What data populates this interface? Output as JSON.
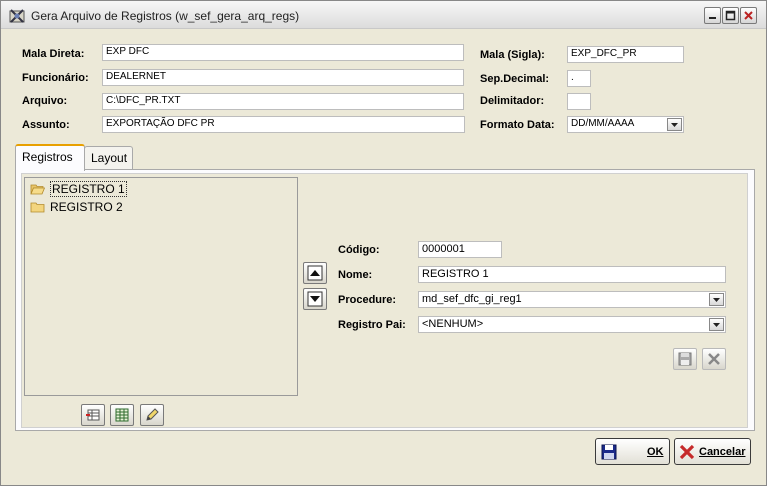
{
  "window": {
    "title": "Gera Arquivo de Registros (w_sef_gera_arq_regs)"
  },
  "form": {
    "mala_direta": {
      "label": "Mala Direta:",
      "value": "EXP DFC"
    },
    "funcionario": {
      "label": "Funcionário:",
      "value": "DEALERNET"
    },
    "arquivo": {
      "label": "Arquivo:",
      "value": "C:\\DFC_PR.TXT"
    },
    "assunto": {
      "label": "Assunto:",
      "value": "EXPORTAÇÃO DFC PR"
    },
    "mala_sigla": {
      "label": "Mala (Sigla):",
      "value": "EXP_DFC_PR"
    },
    "sep_decimal": {
      "label": "Sep.Decimal:",
      "value": "."
    },
    "delimitador": {
      "label": "Delimitador:",
      "value": ""
    },
    "formato_data": {
      "label": "Formato Data:",
      "value": "DD/MM/AAAA"
    }
  },
  "tabs": [
    {
      "label": "Registros",
      "active": true
    },
    {
      "label": "Layout",
      "active": false
    }
  ],
  "tree": {
    "items": [
      {
        "label": "REGISTRO 1",
        "selected": true,
        "icon": "open-folder-icon"
      },
      {
        "label": "REGISTRO 2",
        "selected": false,
        "icon": "folder-icon"
      }
    ]
  },
  "detail": {
    "codigo": {
      "label": "Código:",
      "value": "0000001"
    },
    "nome": {
      "label": "Nome:",
      "value": "REGISTRO 1"
    },
    "procedure": {
      "label": "Procedure:",
      "value": "md_sef_dfc_gi_reg1"
    },
    "registro_pai": {
      "label": "Registro Pai:",
      "value": "<NENHUM>"
    }
  },
  "buttons": {
    "ok": "OK",
    "cancelar": "Cancelar"
  },
  "colors": {
    "window_bg": "#ece9d8",
    "tab_accent": "#e8a000",
    "close_red": "#c0392b"
  }
}
